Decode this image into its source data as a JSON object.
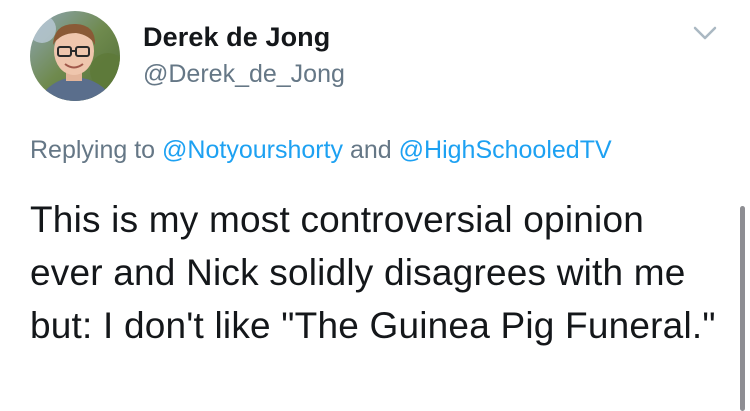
{
  "author": {
    "display_name": "Derek de Jong",
    "handle": "@Derek_de_Jong"
  },
  "reply": {
    "prefix": "Replying to",
    "mention_1": "@Notyourshorty",
    "conjunction": "and",
    "mention_2": "@HighSchooledTV"
  },
  "tweet": {
    "text": "This is my most controversial opinion ever and Nick solidly disagrees with me but: I don't like \"The Guinea Pig Funeral.\""
  },
  "icons": {
    "menu": "chevron-down-icon",
    "avatar": "avatar"
  },
  "colors": {
    "text": "#14171a",
    "secondary": "#657786",
    "link": "#1da1f2",
    "chevron": "#aab8c2"
  }
}
